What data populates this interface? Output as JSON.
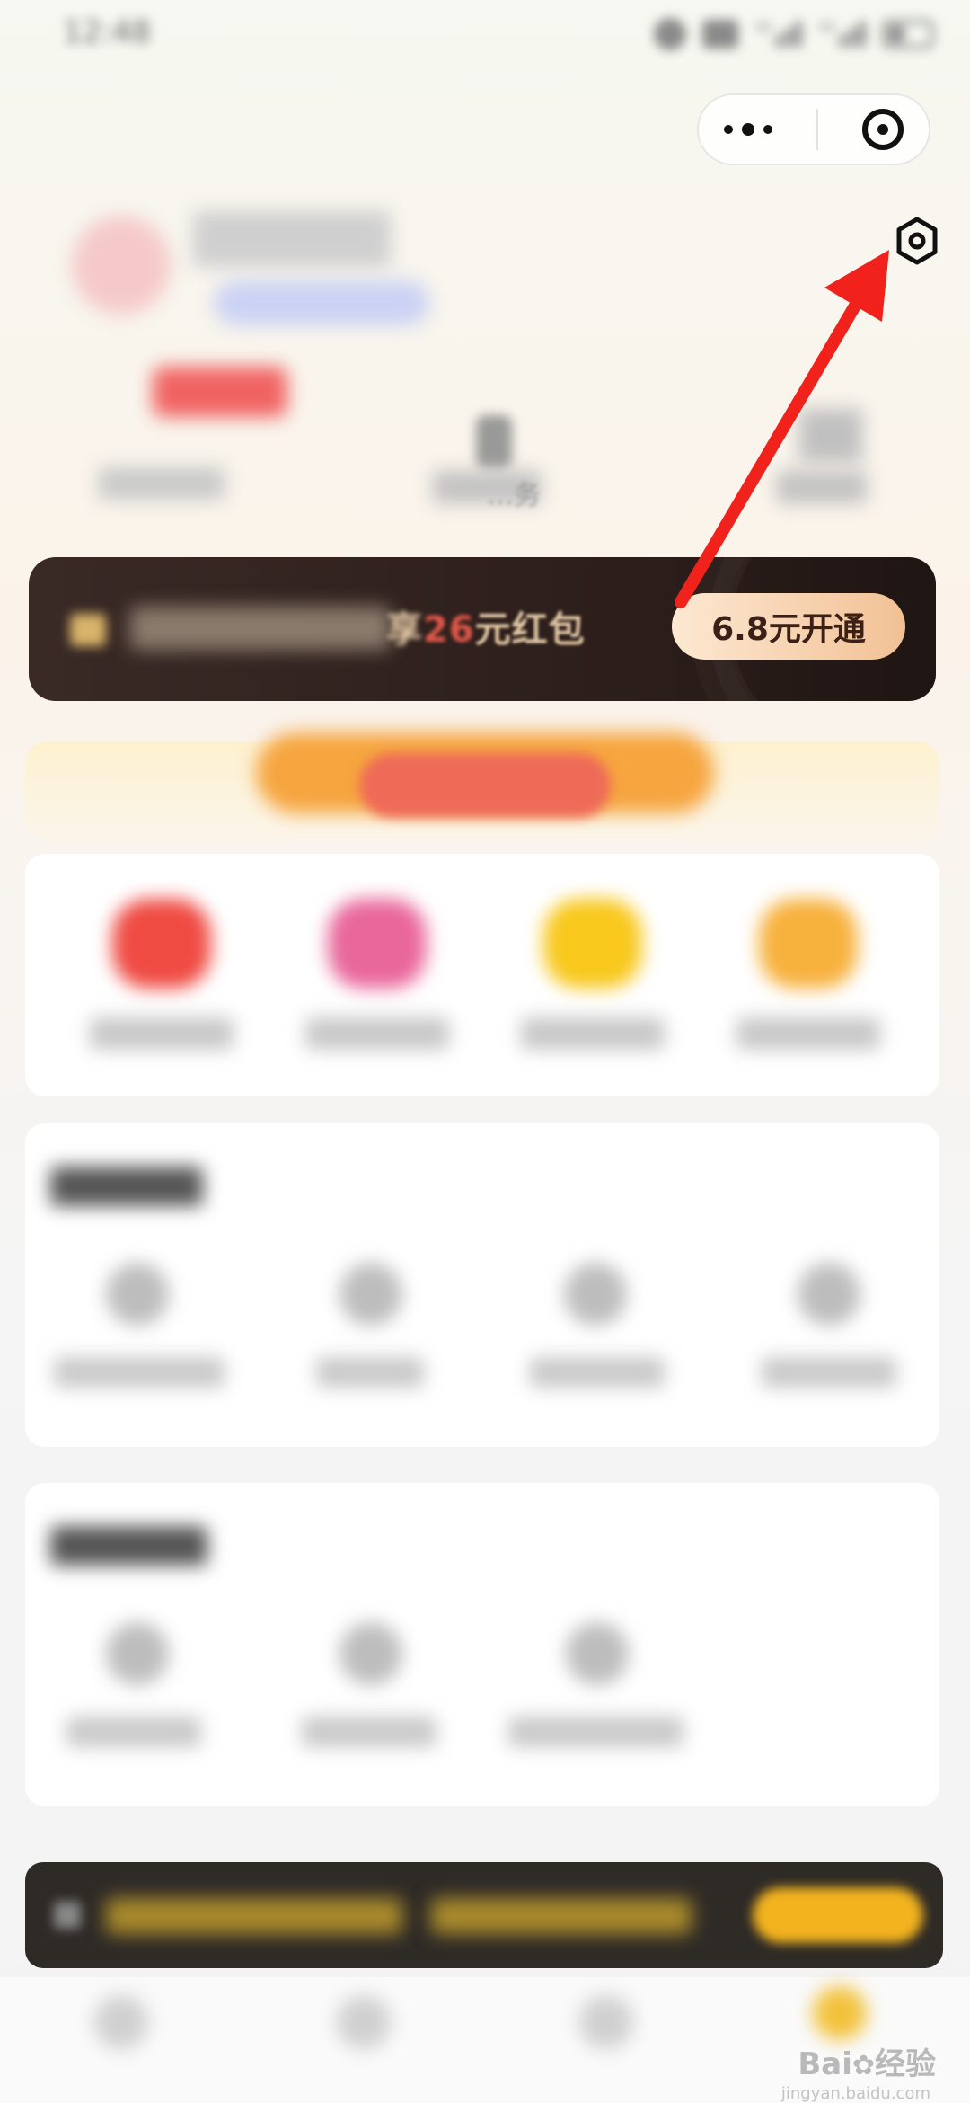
{
  "status_bar": {
    "time": "12:48",
    "icons": [
      "alarm-icon",
      "wifi-icon",
      "signal-4g-icon",
      "signal-4g-icon",
      "battery-icon"
    ],
    "network_label_1": "4G",
    "network_label_2": "4G"
  },
  "capsule": {
    "more_icon": "more-dots-icon",
    "close_icon": "target-icon"
  },
  "settings": {
    "icon": "hexagon-settings-icon"
  },
  "profile": {
    "blurred": true,
    "stat_2_label": "…务"
  },
  "vip_banner": {
    "prefix": "享",
    "highlight": "26",
    "suffix": "元红包",
    "button": "6.8元开通"
  },
  "annotation": {
    "arrow_color": "#f0221b",
    "points_to": "settings"
  },
  "watermark": {
    "brand": "Bai",
    "brand2": "经验",
    "sub": "jingyan.baidu.com"
  },
  "colors": {
    "vip_bg": "#2b1d1a",
    "vip_button": "#f2c195",
    "accent_red": "#e0574a"
  }
}
